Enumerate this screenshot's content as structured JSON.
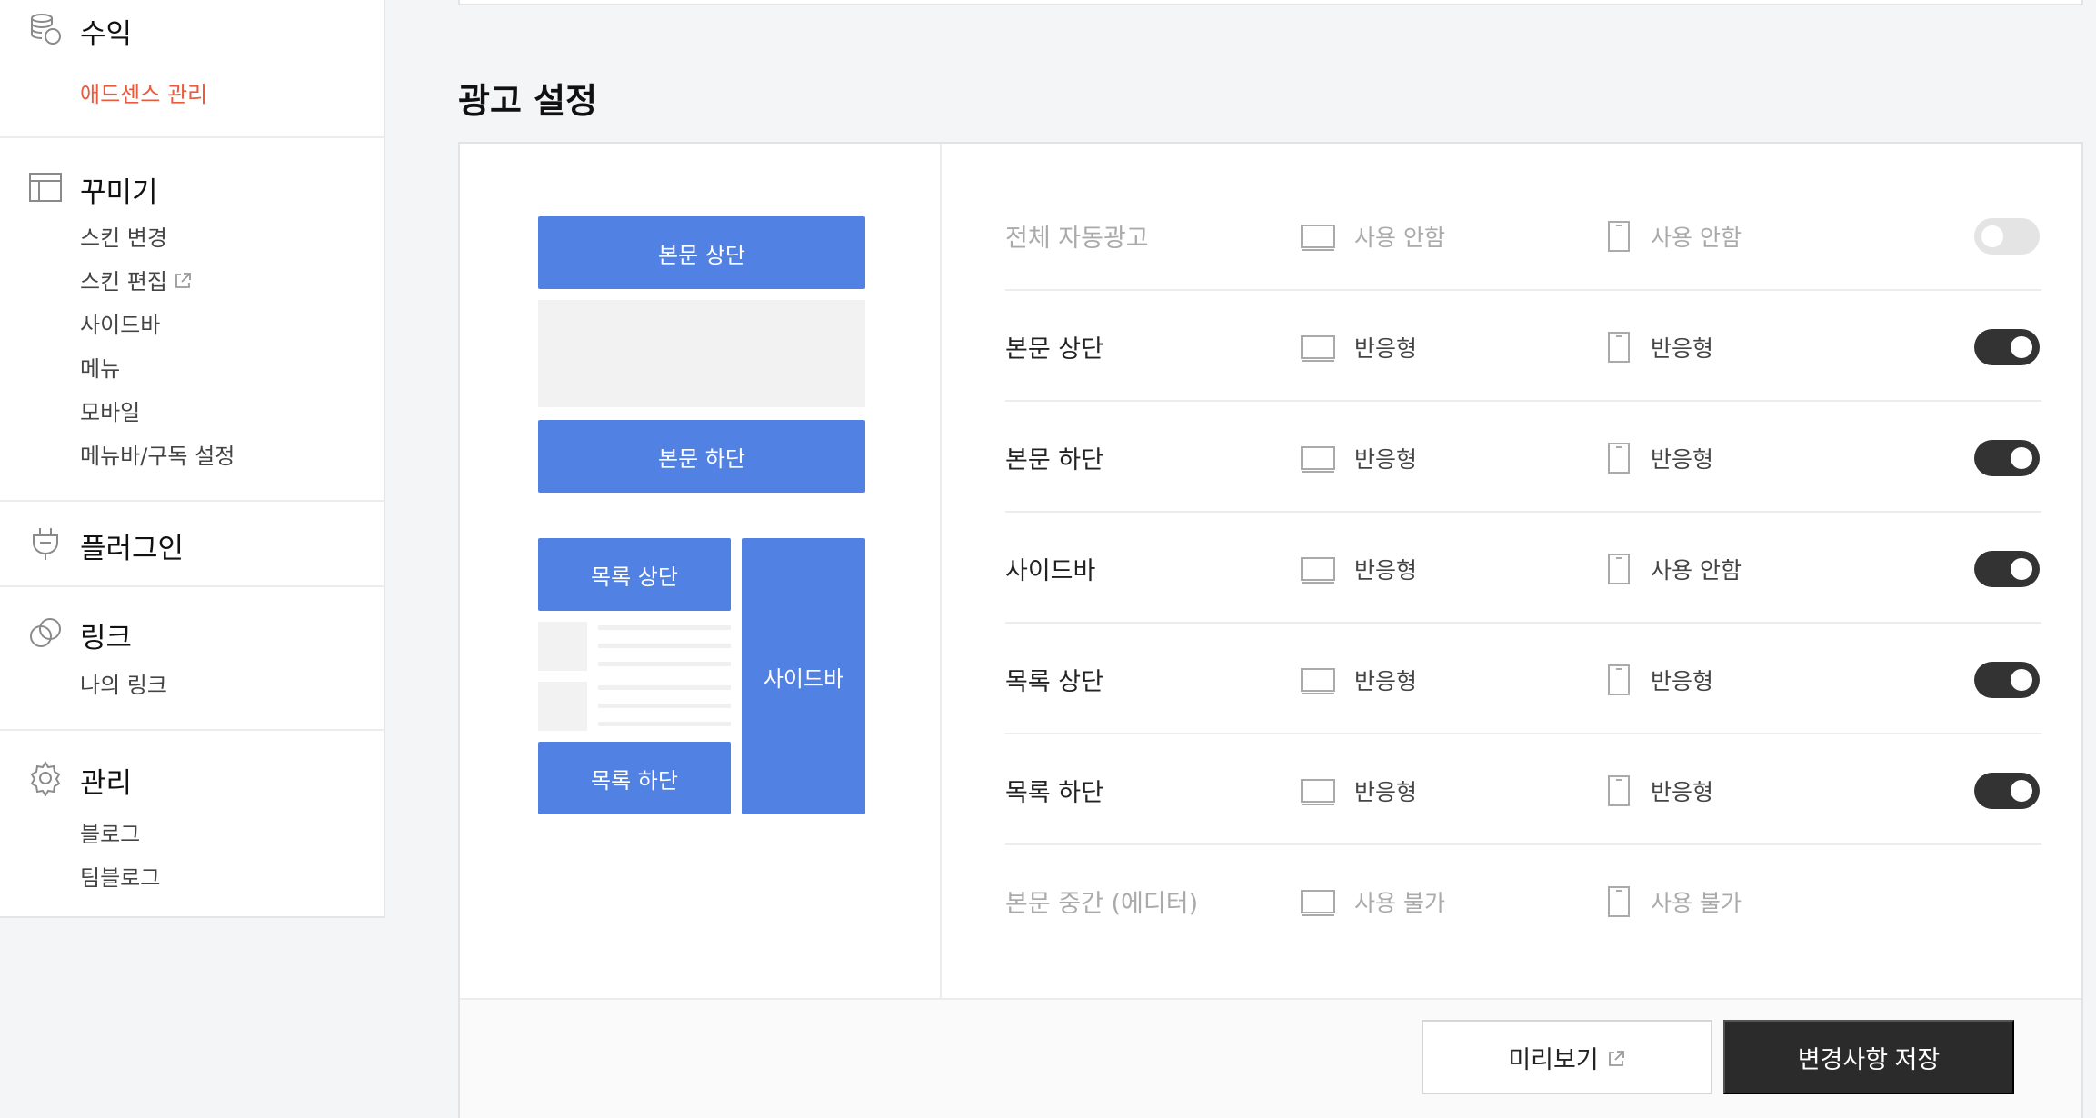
{
  "sidebar": {
    "groups": [
      {
        "title": "수익",
        "icon": "coins-icon",
        "items": [
          "애드센스 관리"
        ]
      },
      {
        "title": "꾸미기",
        "icon": "layout-icon",
        "items": [
          "스킨 변경",
          "스킨 편집",
          "사이드바",
          "메뉴",
          "모바일",
          "메뉴바/구독 설정"
        ]
      },
      {
        "title": "플러그인",
        "icon": "plug-icon",
        "items": []
      },
      {
        "title": "링크",
        "icon": "link-icon",
        "items": [
          "나의 링크"
        ]
      },
      {
        "title": "관리",
        "icon": "gear-icon",
        "items": [
          "블로그",
          "팀블로그"
        ]
      }
    ]
  },
  "ad_settings": {
    "title": "광고 설정",
    "preview": {
      "body_top": "본문 상단",
      "body_bottom": "본문 하단",
      "list_top": "목록 상단",
      "list_bottom": "목록 하단",
      "sidebar": "사이드바"
    },
    "rows": [
      {
        "label": "전체 자동광고",
        "pc": "사용 안함",
        "mobile": "사용 안함",
        "toggle": "off",
        "enabled": false
      },
      {
        "label": "본문 상단",
        "pc": "반응형",
        "mobile": "반응형",
        "toggle": "on",
        "enabled": true
      },
      {
        "label": "본문 하단",
        "pc": "반응형",
        "mobile": "반응형",
        "toggle": "on",
        "enabled": true
      },
      {
        "label": "사이드바",
        "pc": "반응형",
        "mobile": "사용 안함",
        "toggle": "on",
        "enabled": true
      },
      {
        "label": "목록 상단",
        "pc": "반응형",
        "mobile": "반응형",
        "toggle": "on",
        "enabled": true
      },
      {
        "label": "목록 하단",
        "pc": "반응형",
        "mobile": "반응형",
        "toggle": "on",
        "enabled": true
      },
      {
        "label": "본문 중간 (에디터)",
        "pc": "사용 불가",
        "mobile": "사용 불가",
        "toggle": null,
        "enabled": false
      }
    ],
    "buttons": {
      "preview": "미리보기",
      "save": "변경사항 저장"
    }
  },
  "colors": {
    "accent": "#ea5a3d",
    "block": "#5181e3",
    "dark": "#2b2b2b"
  }
}
